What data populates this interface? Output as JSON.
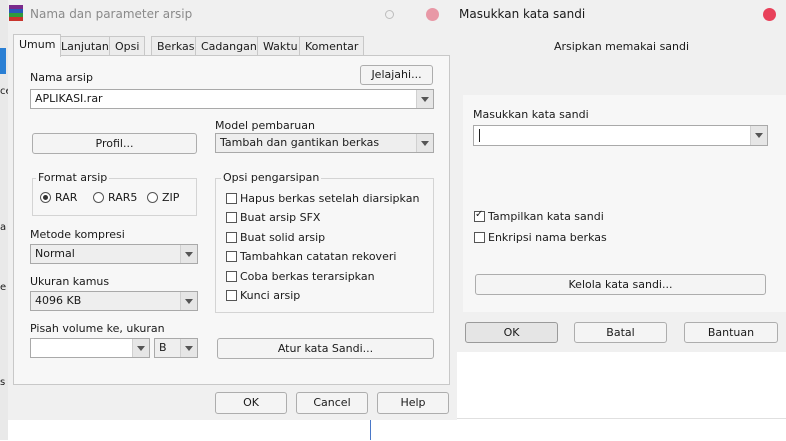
{
  "background": {
    "left_fragments": [
      "ce",
      "a",
      "e",
      "s"
    ]
  },
  "archive_dialog": {
    "title": "Nama dan parameter arsip",
    "tabs": [
      "Umum",
      "Lanjutan",
      "Opsi",
      "Berkas",
      "Cadangan",
      "Waktu",
      "Komentar"
    ],
    "archive_name_label": "Nama arsip",
    "browse_button": "Jelajahi...",
    "archive_name_value": "APLIKASI.rar",
    "profiles_button": "Profil...",
    "update_mode_label": "Model pembaruan",
    "update_mode_value": "Tambah dan gantikan berkas",
    "format_label": "Format arsip",
    "format_options": [
      "RAR",
      "RAR5",
      "ZIP"
    ],
    "format_selected": "RAR",
    "options_label": "Opsi pengarsipan",
    "options": [
      {
        "label": "Hapus berkas setelah diarsipkan",
        "checked": false
      },
      {
        "label": "Buat arsip SFX",
        "checked": false
      },
      {
        "label": "Buat solid arsip",
        "checked": false
      },
      {
        "label": "Tambahkan catatan rekoveri",
        "checked": false
      },
      {
        "label": "Coba berkas terarsipkan",
        "checked": false
      },
      {
        "label": "Kunci arsip",
        "checked": false
      }
    ],
    "compression_label": "Metode kompresi",
    "compression_value": "Normal",
    "dictionary_label": "Ukuran kamus",
    "dictionary_value": "4096 KB",
    "split_label": "Pisah volume ke, ukuran",
    "split_value": "",
    "split_unit": "B",
    "password_button": "Atur kata Sandi...",
    "ok_button": "OK",
    "cancel_button": "Cancel",
    "help_button": "Help"
  },
  "password_dialog": {
    "title": "Masukkan kata sandi",
    "subtitle": "Arsipkan memakai sandi",
    "enter_label": "Masukkan kata sandi",
    "password_value": "",
    "show_password_label": "Tampilkan kata sandi",
    "show_password_checked": true,
    "encrypt_names_label": "Enkripsi nama berkas",
    "encrypt_names_checked": false,
    "organize_button": "Kelola kata sandi...",
    "ok_button": "OK",
    "cancel_button": "Batal",
    "help_button": "Bantuan"
  },
  "colors": {
    "close": "#e8415a",
    "window_bg": "#f0f0f0"
  }
}
